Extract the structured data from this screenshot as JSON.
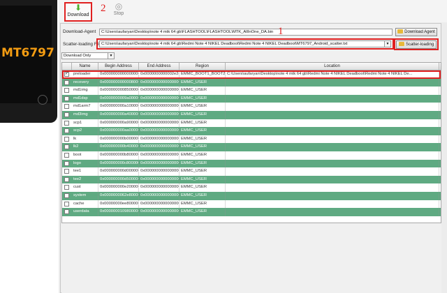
{
  "phone": {
    "chip_label": "MT6797"
  },
  "toolbar": {
    "download_label": "Download",
    "stop_label": "Stop"
  },
  "annotations": {
    "one": "1",
    "two": "2"
  },
  "form": {
    "download_agent_label": "Download-Agent",
    "download_agent_value": "C:\\Users\\aufaryan\\Desktop\\note 4 mtk 64 gb\\FLASHTOOL\\FLASHTOOL\\MTK_AllInOne_DA.bin",
    "download_agent_button": "Download Agent",
    "scatter_label": "Scatter-loading File",
    "scatter_value": "C:\\Users\\aufaryan\\Desktop\\note 4 mtk 64 gb\\Redmi Note 4 NIKEL Deadboot\\Redmi Note 4 NIKEL Deadboot\\MT6797_Android_scatter.txt",
    "scatter_button": "Scatter-loading",
    "mode_selected": "Download Only"
  },
  "table": {
    "columns": [
      "",
      "Name",
      "Begin Address",
      "End Address",
      "Region",
      "Location"
    ],
    "rows": [
      {
        "checked": true,
        "name": "preloader",
        "begin": "0x0000000000000000",
        "end": "0x0000000000002e2cb",
        "region": "EMMC_BOOT1_BOOT2",
        "location": "C:\\Users\\aufaryan\\Desktop\\note 4 mtk 64 gb\\Redmi Note 4 NIKEL Deadboot\\Redmi Note 4 NIKEL De...",
        "style": "white"
      },
      {
        "checked": false,
        "name": "recovery",
        "begin": "0x0000000000008000",
        "end": "0x0000000000000000",
        "region": "EMMC_USER",
        "location": "",
        "style": "green"
      },
      {
        "checked": false,
        "name": "md1img",
        "begin": "0x0000000008500000",
        "end": "0x0000000000000000",
        "region": "EMMC_USER",
        "location": "",
        "style": "white"
      },
      {
        "checked": false,
        "name": "md1dsp",
        "begin": "0x0000000009a00000",
        "end": "0x0000000000000000",
        "region": "EMMC_USER",
        "location": "",
        "style": "green"
      },
      {
        "checked": false,
        "name": "md1arm7",
        "begin": "0x000000000a100000",
        "end": "0x0000000000000000",
        "region": "EMMC_USER",
        "location": "",
        "style": "white"
      },
      {
        "checked": false,
        "name": "md3img",
        "begin": "0x000000000a400000",
        "end": "0x0000000000000000",
        "region": "EMMC_USER",
        "location": "",
        "style": "green"
      },
      {
        "checked": false,
        "name": "scp1",
        "begin": "0x000000000a900000",
        "end": "0x0000000000000000",
        "region": "EMMC_USER",
        "location": "",
        "style": "white"
      },
      {
        "checked": false,
        "name": "scp2",
        "begin": "0x000000000aa00000",
        "end": "0x0000000000000000",
        "region": "EMMC_USER",
        "location": "",
        "style": "green"
      },
      {
        "checked": false,
        "name": "lk",
        "begin": "0x000000000b000000",
        "end": "0x0000000000000000",
        "region": "EMMC_USER",
        "location": "",
        "style": "white"
      },
      {
        "checked": false,
        "name": "lk2",
        "begin": "0x000000000b400000",
        "end": "0x0000000000000000",
        "region": "EMMC_USER",
        "location": "",
        "style": "green"
      },
      {
        "checked": false,
        "name": "boot",
        "begin": "0x000000000b800000",
        "end": "0x0000000000000000",
        "region": "EMMC_USER",
        "location": "",
        "style": "white"
      },
      {
        "checked": false,
        "name": "logo",
        "begin": "0x000000000c800000",
        "end": "0x0000000000000000",
        "region": "EMMC_USER",
        "location": "",
        "style": "green"
      },
      {
        "checked": false,
        "name": "tee1",
        "begin": "0x000000000d000000",
        "end": "0x0000000000000000",
        "region": "EMMC_USER",
        "location": "",
        "style": "white"
      },
      {
        "checked": false,
        "name": "tee2",
        "begin": "0x000000000d500000",
        "end": "0x0000000000000000",
        "region": "EMMC_USER",
        "location": "",
        "style": "green"
      },
      {
        "checked": false,
        "name": "cust",
        "begin": "0x000000000e200000",
        "end": "0x0000000000000000",
        "region": "EMMC_USER",
        "location": "",
        "style": "white"
      },
      {
        "checked": false,
        "name": "system",
        "begin": "0x0000000062e800000",
        "end": "0x0000000000000000",
        "region": "EMMC_USER",
        "location": "",
        "style": "green"
      },
      {
        "checked": false,
        "name": "cache",
        "begin": "0x00000000ee800000",
        "end": "0x0000000000000000",
        "region": "EMMC_USER",
        "location": "",
        "style": "white"
      },
      {
        "checked": false,
        "name": "userdata",
        "begin": "0x0000000109800000",
        "end": "0x0000000000000000",
        "region": "EMMC_USER",
        "location": "",
        "style": "green"
      }
    ]
  },
  "colors": {
    "accent_red": "#e02020",
    "row_green": "#5faa82",
    "download_icon": "#4caf2a"
  },
  "icons": {
    "download": "download-arrow-icon",
    "stop": "stop-icon",
    "folder": "folder-icon",
    "checkbox": "checkbox-icon"
  }
}
